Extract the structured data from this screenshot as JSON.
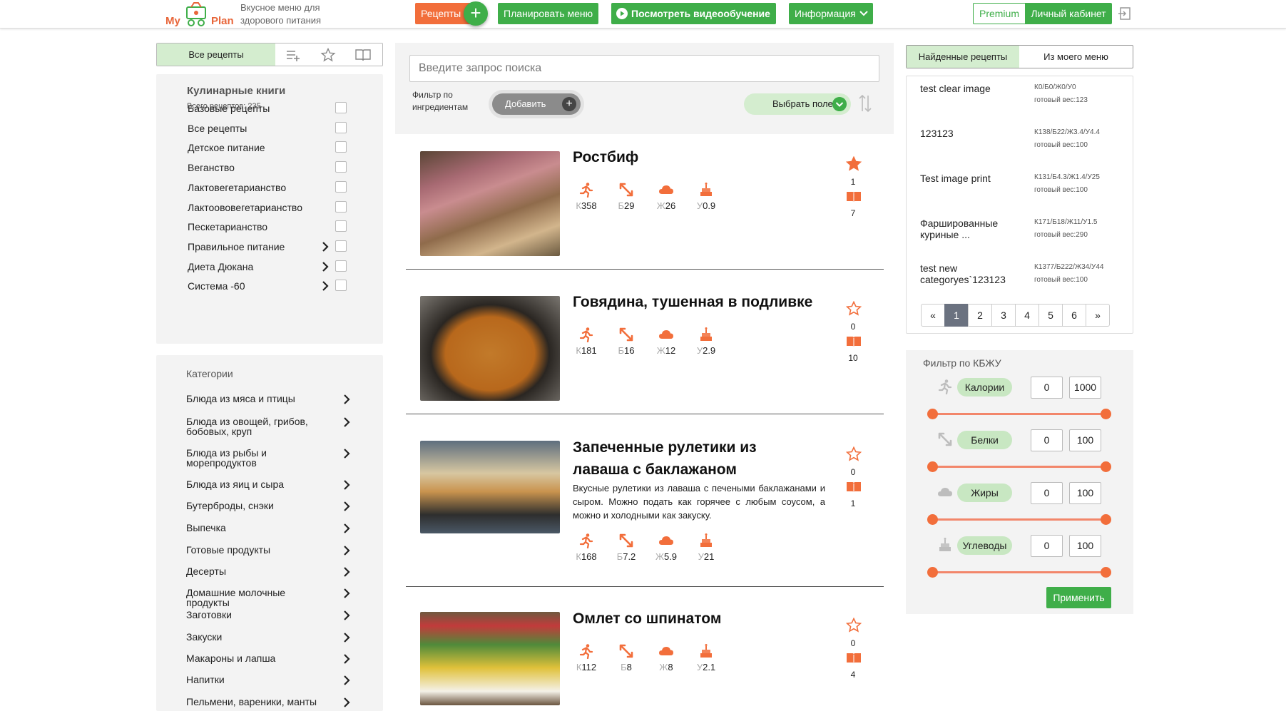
{
  "header": {
    "logo_left": "My",
    "logo_right": "Plan",
    "tagline_1": "Вкусное меню для",
    "tagline_2": "здорового питания",
    "recipes_btn": "Рецепты",
    "plus": "+",
    "plan_menu": "Планировать меню",
    "video": "Посмотреть видеообучение",
    "info": "Информация",
    "premium": "Premium",
    "cabinet": "Личный кабинет"
  },
  "left_tabs": {
    "all": "Все рецепты"
  },
  "books": {
    "title": "Кулинарные книги",
    "subtitle": "Всего рецептов: 235",
    "items": [
      {
        "label": "Базовые рецепты",
        "has_sub": false
      },
      {
        "label": "Все рецепты",
        "has_sub": false
      },
      {
        "label": "Детское питание",
        "has_sub": false
      },
      {
        "label": "Веганство",
        "has_sub": false
      },
      {
        "label": "Лактовегетарианство",
        "has_sub": false
      },
      {
        "label": "Лактоововегетарианство",
        "has_sub": false
      },
      {
        "label": "Пескетарианство",
        "has_sub": false
      },
      {
        "label": "Правильное питание",
        "has_sub": true
      },
      {
        "label": "Диета Дюкана",
        "has_sub": true
      },
      {
        "label": "Система -60",
        "has_sub": true
      }
    ]
  },
  "categories": {
    "title": "Категории",
    "items": [
      "Блюда из мяса и птицы",
      "Блюда из овощей, грибов, бобовых, круп",
      "Блюда из рыбы и морепродуктов",
      "Блюда из яиц и сыра",
      "Бутерброды, снэки",
      "Выпечка",
      "Готовые продукты",
      "Десерты",
      "Домашние молочные продукты",
      "Заготовки",
      "Закуски",
      "Макароны и лапша",
      "Напитки",
      "Пельмени, вареники, манты"
    ]
  },
  "search": {
    "placeholder": "Введите запрос поиска",
    "filter_label_1": "Фильтр по",
    "filter_label_2": "ингредиентам",
    "add": "Добавить",
    "add_plus": "+",
    "choose_field": "Выбрать поле"
  },
  "recipes": [
    {
      "title": "Ростбиф",
      "desc": "",
      "k": "358",
      "b": "29",
      "zh": "26",
      "u": "0.9",
      "fav": "1",
      "books": "7",
      "starred": true
    },
    {
      "title": "Говядина, тушенная в подливке",
      "desc": "",
      "k": "181",
      "b": "16",
      "zh": "12",
      "u": "2.9",
      "fav": "0",
      "books": "10",
      "starred": false
    },
    {
      "title": "Запеченные рулетики из лаваша с баклажаном",
      "desc": "Вкусные рулетики из лаваша с печеными баклажанами и сыром. Можно подать как горячее с любым соусом, а можно и холодными как закуску.",
      "k": "168",
      "b": "7.2",
      "zh": "5.9",
      "u": "21",
      "fav": "0",
      "books": "1",
      "starred": false
    },
    {
      "title": "Омлет со шпинатом",
      "desc": "",
      "k": "112",
      "b": "8",
      "zh": "8",
      "u": "2.1",
      "fav": "0",
      "books": "4",
      "starred": false
    }
  ],
  "nut_letters": {
    "k": "К",
    "b": "Б",
    "zh": "Ж",
    "u": "У"
  },
  "right_tabs": {
    "found": "Найденные рецепты",
    "mine": "Из моего меню"
  },
  "found": [
    {
      "name": "test clear image",
      "kbju": "К0/Б0/Ж0/У0",
      "weight": "готовый вес:123"
    },
    {
      "name": "123123",
      "kbju": "К138/Б22/Ж3.4/У4.4",
      "weight": "готовый вес:100"
    },
    {
      "name": "Test image print",
      "kbju": "К131/Б4.3/Ж1.4/У25",
      "weight": "готовый вес:100"
    },
    {
      "name": "Фаршированные куриные ...",
      "kbju": "К171/Б18/Ж11/У1.5",
      "weight": "готовый вес:290"
    },
    {
      "name": "test new categoryes`123123",
      "kbju": "К1377/Б222/Ж34/У44",
      "weight": "готовый вес:100"
    }
  ],
  "pager": [
    "«",
    "1",
    "2",
    "3",
    "4",
    "5",
    "6",
    "»"
  ],
  "pager_active": "1",
  "kbju": {
    "title": "Фильтр по КБЖУ",
    "rows": [
      {
        "label": "Калории",
        "min": "0",
        "max": "1000",
        "icon": "run-icon"
      },
      {
        "label": "Белки",
        "min": "0",
        "max": "100",
        "icon": "muscle-icon"
      },
      {
        "label": "Жиры",
        "min": "0",
        "max": "100",
        "icon": "cloud-icon"
      },
      {
        "label": "Углеводы",
        "min": "0",
        "max": "100",
        "icon": "cake-icon"
      }
    ],
    "apply": "Применить"
  },
  "colors": {
    "green": "#3fae49",
    "orange": "#f26e3b",
    "light_green": "#d4edcf"
  }
}
